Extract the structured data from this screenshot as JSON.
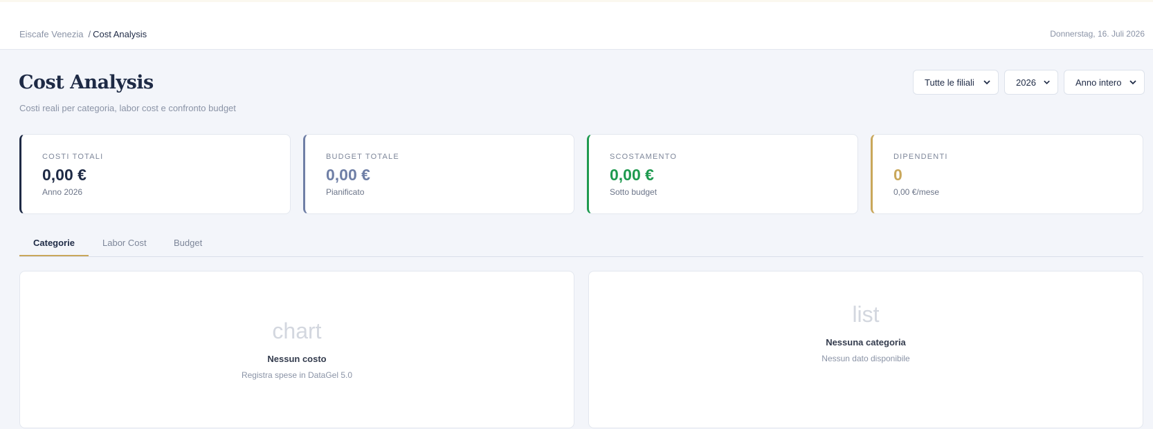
{
  "header": {
    "breadcrumb": {
      "root": "Eiscafe Venezia",
      "separator": "/",
      "current": "Cost Analysis"
    },
    "date": "Donnerstag, 16. Juli 2026"
  },
  "page": {
    "title": "Cost Analysis",
    "subtitle": "Costi reali per categoria, labor cost e confronto budget"
  },
  "filters": {
    "branch": "Tutte le filiali",
    "year": "2026",
    "period": "Anno intero"
  },
  "kpis": [
    {
      "label": "COSTI TOTALI",
      "value": "0,00 €",
      "sub": "Anno 2026",
      "color": "#1e2a45"
    },
    {
      "label": "BUDGET TOTALE",
      "value": "0,00 €",
      "sub": "Pianificato",
      "color": "#6f7fa6"
    },
    {
      "label": "SCOSTAMENTO",
      "value": "0,00 €",
      "sub": "Sotto budget",
      "color": "#1e9a4f"
    },
    {
      "label": "DIPENDENTI",
      "value": "0",
      "sub": "0,00 €/mese",
      "color": "#c9a75a"
    }
  ],
  "tabs": [
    {
      "label": "Categorie",
      "active": true
    },
    {
      "label": "Labor Cost",
      "active": false
    },
    {
      "label": "Budget",
      "active": false
    }
  ],
  "panels": {
    "left": {
      "placeholder": "chart",
      "title": "Nessun costo",
      "hint": "Registra spese in DataGel 5.0"
    },
    "right": {
      "placeholder": "list",
      "title": "Nessuna categoria",
      "hint": "Nessun dato disponibile"
    }
  },
  "colors": {
    "accent": "#c9a75a",
    "background": "#f3f5fa"
  }
}
